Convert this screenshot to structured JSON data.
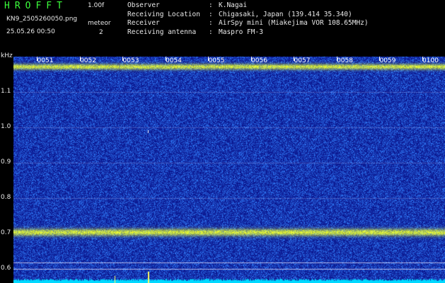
{
  "header": {
    "brand": "HROFFT",
    "version": "1.00f",
    "filename": "KN9_2505260050.png",
    "datetime": "25.05.26 00:50",
    "meteor_label": "meteor",
    "meteor_count": "2",
    "meta": [
      {
        "key": "Observer",
        "value": "K.Nagai"
      },
      {
        "key": "Receiving Location",
        "value": "Chigasaki, Japan (139.414 35.340)"
      },
      {
        "key": "Receiver",
        "value": "AirSpy mini (Miakejima VOR 108.65MHz)"
      },
      {
        "key": "Receiving antenna",
        "value": "Maspro FM-3"
      }
    ]
  },
  "axis": {
    "unit": "kHz",
    "y_ticks": [
      "1.1",
      "1.0",
      "0.9",
      "0.8",
      "0.7",
      "0.6"
    ],
    "time_ticks": [
      "0051",
      "0052",
      "0053",
      "0054",
      "0055",
      "0056",
      "0057",
      "0058",
      "0059",
      "0100"
    ]
  },
  "colors": {
    "background": "#000000",
    "noise_low": "#0a1a9a",
    "noise_high": "#2c6cff",
    "band": "#ffff40",
    "text": "#e8e8e8",
    "brand": "#3cff3c"
  }
}
